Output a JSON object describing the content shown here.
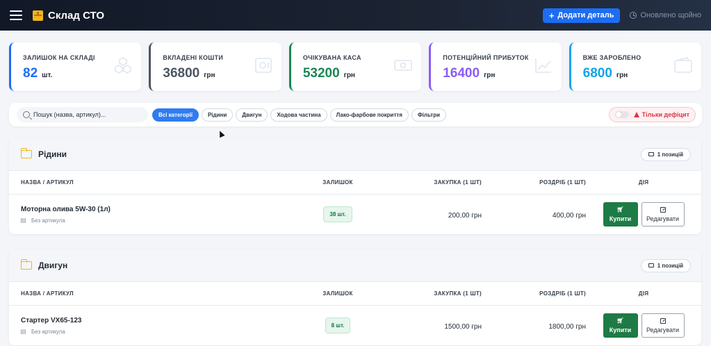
{
  "header": {
    "title": "Склад СТО",
    "add_button": "Додати деталь",
    "updated_text": "Оновлено щойно"
  },
  "stats": [
    {
      "label": "ЗАЛИШОК НА СКЛАДІ",
      "value": "82",
      "unit": "шт.",
      "color": "#1d6df2",
      "icon": "cubes-icon"
    },
    {
      "label": "ВКЛАДЕНІ КОШТИ",
      "value": "36800",
      "unit": "грн",
      "color": "#4b5563",
      "icon": "safe-icon"
    },
    {
      "label": "ОЧІКУВАНА КАСА",
      "value": "53200",
      "unit": "грн",
      "color": "#198754",
      "icon": "cash-icon"
    },
    {
      "label": "ПОТЕНЦІЙНИЙ ПРИБУТОК",
      "value": "16400",
      "unit": "грн",
      "color": "#8b5cf6",
      "icon": "chart-line-icon"
    },
    {
      "label": "ВЖЕ ЗАРОБЛЕНО",
      "value": "6800",
      "unit": "грн",
      "color": "#0ea5e9",
      "icon": "wallet-icon"
    }
  ],
  "filters": {
    "search_placeholder": "Пошук (назва, артикул)...",
    "chips": [
      "Всі категорії",
      "Рідини",
      "Двигун",
      "Ходова частина",
      "Лако-фарбове покриття",
      "Фільтри"
    ],
    "deficit_label": "Тільки дефіцит"
  },
  "table_headers": {
    "name": "НАЗВА / АРТИКУЛ",
    "stock": "ЗАЛИШОК",
    "buy": "ЗАКУПКА (1 ШТ)",
    "sell": "РОЗДРІБ (1 ШТ)",
    "action": "ДІЯ"
  },
  "buttons": {
    "buy": "Купити",
    "edit": "Редагувати"
  },
  "sections": [
    {
      "title": "Рідини",
      "count": "1 позицій",
      "items": [
        {
          "name": "Моторна олива 5W-30 (1л)",
          "sku": "Без артикула",
          "stock": "38 шт.",
          "buy": "200,00 грн",
          "sell": "400,00 грн"
        }
      ]
    },
    {
      "title": "Двигун",
      "count": "1 позицій",
      "items": [
        {
          "name": "Стартер VX65-123",
          "sku": "Без артикула",
          "stock": "8 шт.",
          "buy": "1500,00 грн",
          "sell": "1800,00 грн"
        }
      ]
    }
  ]
}
